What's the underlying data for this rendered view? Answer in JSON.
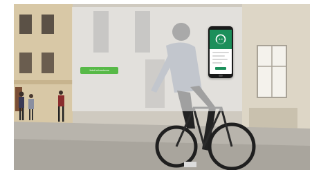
{
  "hero": {
    "cta_label": "Jetzt informieren",
    "app_score": "4.4"
  },
  "colors": {
    "cta_green": "#57b947",
    "app_green": "#1b8f5a"
  }
}
